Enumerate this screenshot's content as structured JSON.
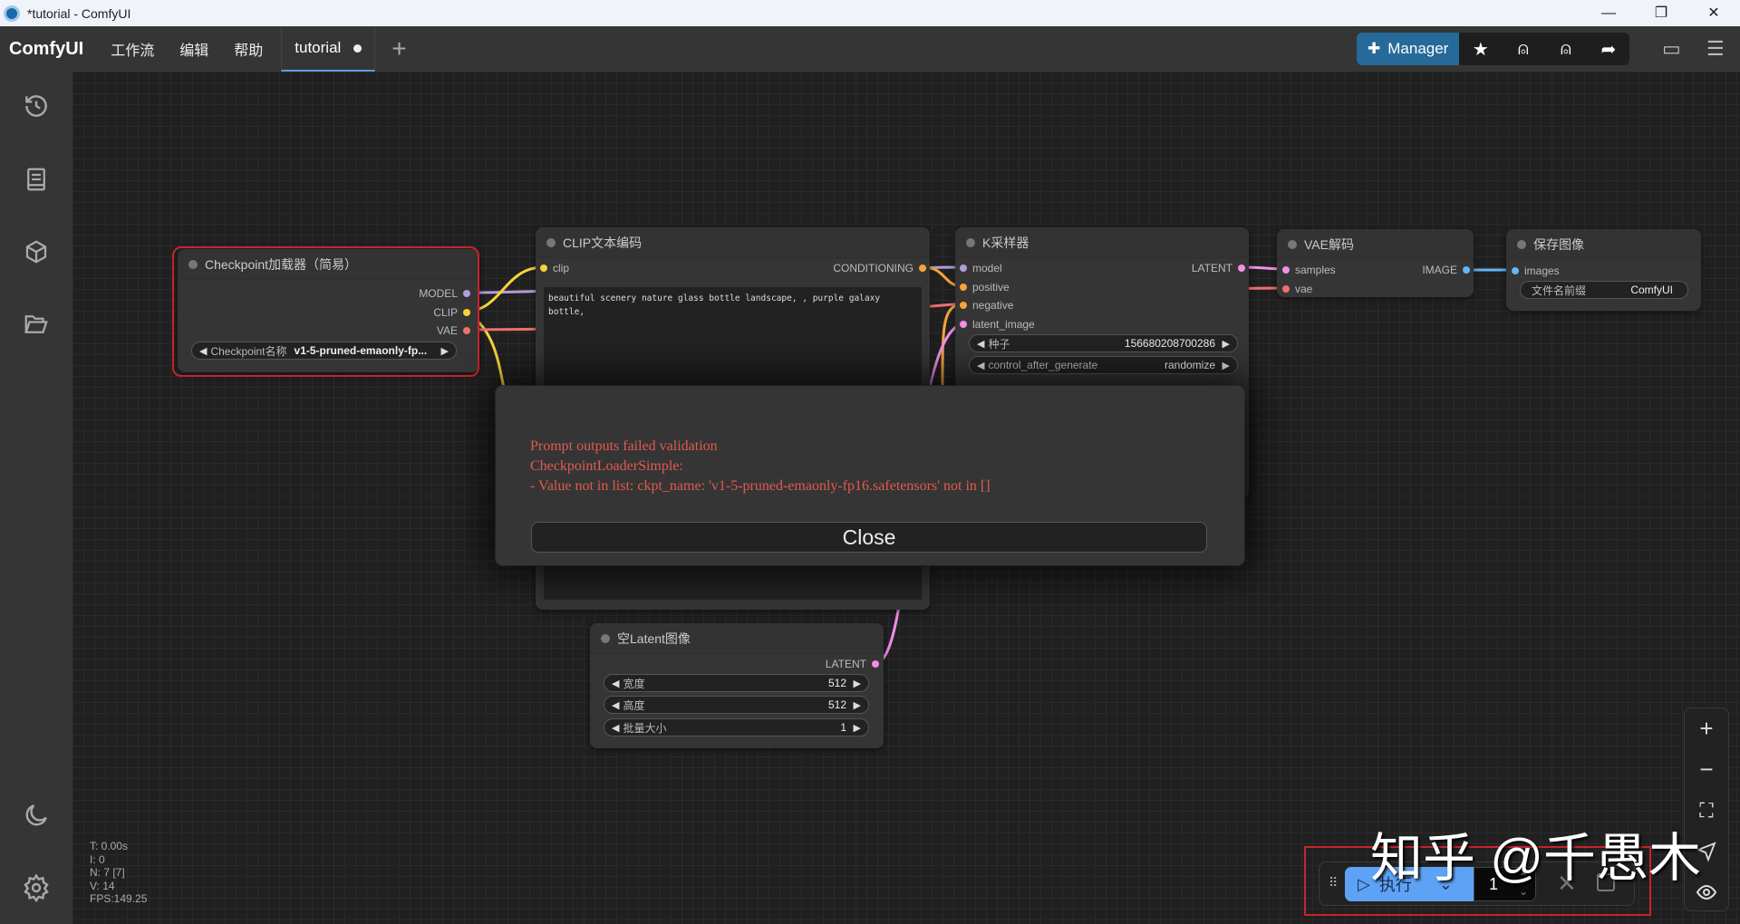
{
  "window": {
    "title": "*tutorial - ComfyUI",
    "minimize": "—",
    "maximize": "❐",
    "close": "✕"
  },
  "menubar": {
    "brand": "ComfyUI",
    "menus": [
      "工作流",
      "编辑",
      "帮助"
    ],
    "tab": "tutorial",
    "new_tab": "+",
    "manager": "Manager"
  },
  "nodes": {
    "checkpoint": {
      "title": "Checkpoint加载器（简易）",
      "outputs": [
        "MODEL",
        "CLIP",
        "VAE"
      ],
      "widget_label": "Checkpoint名称",
      "widget_value": "v1-5-pruned-emaonly-fp..."
    },
    "clip": {
      "title": "CLIP文本编码",
      "input": "clip",
      "output": "CONDITIONING",
      "text": "beautiful scenery nature glass bottle landscape, , purple galaxy bottle,"
    },
    "ksampler": {
      "title": "K采样器",
      "inputs": [
        "model",
        "positive",
        "negative",
        "latent_image"
      ],
      "output": "LATENT",
      "widgets": [
        {
          "label": "种子",
          "value": "156680208700286"
        },
        {
          "label": "control_after_generate",
          "value": "randomize"
        }
      ]
    },
    "vae": {
      "title": "VAE解码",
      "inputs": [
        "samples",
        "vae"
      ],
      "output": "IMAGE"
    },
    "save": {
      "title": "保存图像",
      "input": "images",
      "widget_label": "文件名前缀",
      "widget_value": "ComfyUI"
    },
    "latent": {
      "title": "空Latent图像",
      "output": "LATENT",
      "widgets": [
        {
          "label": "宽度",
          "value": "512"
        },
        {
          "label": "高度",
          "value": "512"
        },
        {
          "label": "批量大小",
          "value": "1"
        }
      ]
    }
  },
  "dialog": {
    "lines": [
      "Prompt outputs failed validation",
      "CheckpointLoaderSimple:",
      "- Value not in list: ckpt_name: 'v1-5-pruned-emaonly-fp16.safetensors' not in []"
    ],
    "close": "Close"
  },
  "stats": [
    "T: 0.00s",
    "I: 0",
    "N: 7 [7]",
    "V: 14",
    "FPS:149.25"
  ],
  "runbar": {
    "run": "执行",
    "count": "1"
  },
  "watermark": "知乎 @千愚木",
  "colors": {
    "model": "#b39ddb",
    "clip": "#f5d33b",
    "vae": "#ef6f6f",
    "conditioning": "#f5a53b",
    "latent": "#f08ee8",
    "image": "#64b5f6",
    "accent": "#266a99",
    "error": "#e05a4f"
  }
}
